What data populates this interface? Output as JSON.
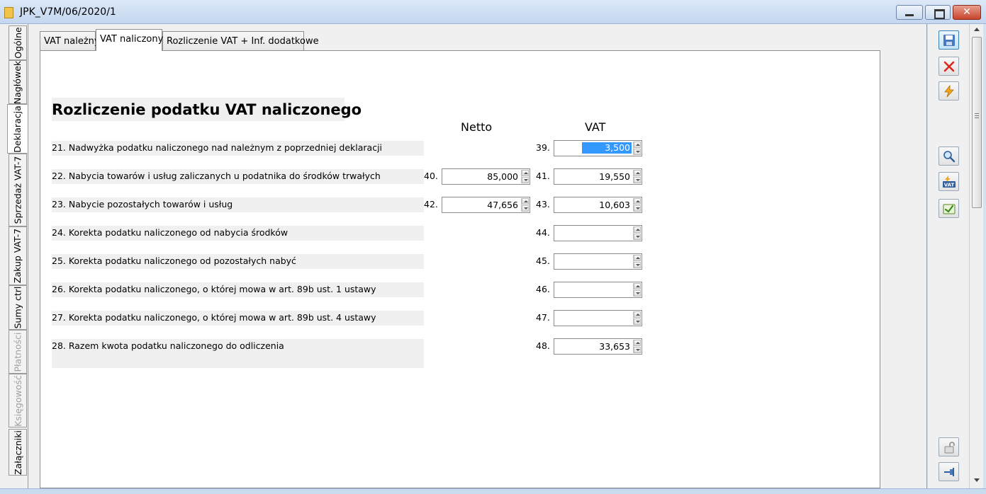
{
  "window": {
    "title": "JPK_V7M/06/2020/1",
    "close_glyph": "✕"
  },
  "left_tabs": [
    {
      "label": "Ogólne"
    },
    {
      "label": "Nagłówek"
    },
    {
      "label": "Deklaracja"
    },
    {
      "label": "Sprzedaż VAT-7"
    },
    {
      "label": "Zakup VAT-7"
    },
    {
      "label": "Sumy ctrl"
    },
    {
      "label": "Płatności"
    },
    {
      "label": "Księgowość"
    },
    {
      "label": "Załączniki"
    }
  ],
  "top_tabs": [
    {
      "label": "VAT należny"
    },
    {
      "label": "VAT naliczony"
    },
    {
      "label": "Rozliczenie VAT + Inf. dodatkowe"
    }
  ],
  "form": {
    "heading": "Rozliczenie podatku VAT naliczonego",
    "col_netto": "Netto",
    "col_vat": "VAT",
    "rows": [
      {
        "label": "21. Nadwyżka podatku naliczonego nad należnym z poprzedniej deklaracji",
        "vat_no": "39.",
        "vat": "3,500"
      },
      {
        "label": "22. Nabycia towarów i usług zaliczanych u podatnika do środków trwałych",
        "netto_no": "40.",
        "netto": "85,000",
        "vat_no": "41.",
        "vat": "19,550"
      },
      {
        "label": "23. Nabycie pozostałych towarów i usług",
        "netto_no": "42.",
        "netto": "47,656",
        "vat_no": "43.",
        "vat": "10,603"
      },
      {
        "label": "24.  Korekta podatku naliczonego od nabycia środków",
        "vat_no": "44.",
        "vat": ""
      },
      {
        "label": "25. Korekta podatku naliczonego od pozostałych nabyć",
        "vat_no": "45.",
        "vat": ""
      },
      {
        "label": "26. Korekta podatku naliczonego, o której mowa w art. 89b ust. 1 ustawy",
        "vat_no": "46.",
        "vat": ""
      },
      {
        "label": "27. Korekta podatku naliczonego, o której mowa w art. 89b ust. 4 ustawy",
        "vat_no": "47.",
        "vat": ""
      },
      {
        "label": "28.  Razem kwota podatku naliczonego do odliczenia",
        "vat_no": "48.",
        "vat": "33,653"
      }
    ]
  },
  "toolbar": {
    "icons": [
      "save-icon",
      "cancel-icon",
      "lightning-icon",
      "preview-icon",
      "vat-icon",
      "approve-icon",
      "unlock-icon",
      "pin-icon"
    ],
    "vat_icon_text": "VAT"
  },
  "colors": {
    "selection": "#3399ff",
    "label_bg": "#f0f0f0",
    "cancel": "#d9261c",
    "lightning": "#f0a818"
  }
}
